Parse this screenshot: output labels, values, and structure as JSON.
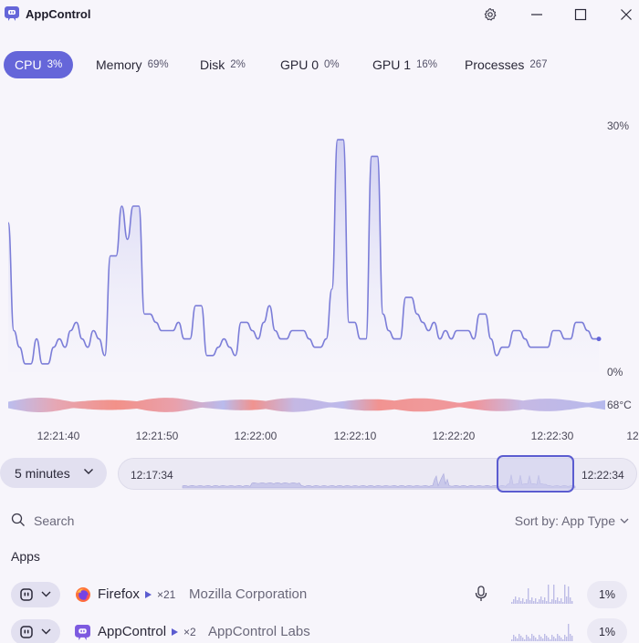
{
  "app": {
    "title": "AppControl"
  },
  "tabs": [
    {
      "label": "CPU",
      "value": "3%",
      "active": true
    },
    {
      "label": "Memory",
      "value": "69%"
    },
    {
      "label": "Disk",
      "value": "2%"
    },
    {
      "label": "GPU 0",
      "value": "0%"
    },
    {
      "label": "GPU 1",
      "value": "16%"
    },
    {
      "label": "Processes",
      "value": "267"
    }
  ],
  "chart_data": {
    "type": "area",
    "series": [
      {
        "values": [
          18,
          5,
          3,
          1,
          1,
          4,
          1,
          1,
          3,
          4,
          3,
          5,
          6,
          4,
          3,
          5,
          4,
          2,
          14,
          14,
          20,
          16,
          20,
          20,
          7,
          7,
          6,
          5,
          5,
          5,
          6,
          4,
          4,
          8,
          8,
          2,
          2,
          3,
          4,
          3,
          2,
          6,
          6,
          5,
          4,
          6,
          8,
          5,
          4,
          4,
          5,
          5,
          5,
          4,
          3,
          3,
          4,
          10,
          28,
          28,
          6,
          6,
          4,
          4,
          26,
          26,
          7,
          5,
          4,
          4,
          9,
          9,
          7,
          6,
          5,
          6,
          4,
          5,
          4,
          5,
          5,
          5,
          4,
          7,
          7,
          4,
          2,
          3,
          3,
          5,
          5,
          4,
          3,
          3,
          3,
          3,
          5,
          5,
          4,
          4,
          6,
          6,
          5,
          4,
          4
        ]
      }
    ],
    "ylim": [
      0,
      30
    ],
    "y_max_label": "30%",
    "y_min_label": "0%",
    "temperature_label": "68°C",
    "x_ticks": [
      "12:21:40",
      "12:21:50",
      "12:22:00",
      "12:22:10",
      "12:22:20",
      "12:22:30",
      "12"
    ]
  },
  "controls": {
    "range_label": "5 minutes",
    "overview_start": "12:17:34",
    "overview_end": "12:22:34",
    "search_placeholder": "Search",
    "sort_label": "Sort by: App Type"
  },
  "section": {
    "title": "Apps"
  },
  "apps": [
    {
      "name": "Firefox",
      "count": "×21",
      "publisher": "Mozilla Corporation",
      "percent": "1%",
      "icon": "firefox-icon"
    },
    {
      "name": "AppControl",
      "count": "×2",
      "publisher": "AppControl Labs",
      "percent": "1%",
      "icon": "appcontrol-icon"
    }
  ],
  "colors": {
    "accent": "#6566d9",
    "line": "#7b7dd8",
    "temp_hot": "#f0908a",
    "temp_cool": "#b6b9ec"
  }
}
